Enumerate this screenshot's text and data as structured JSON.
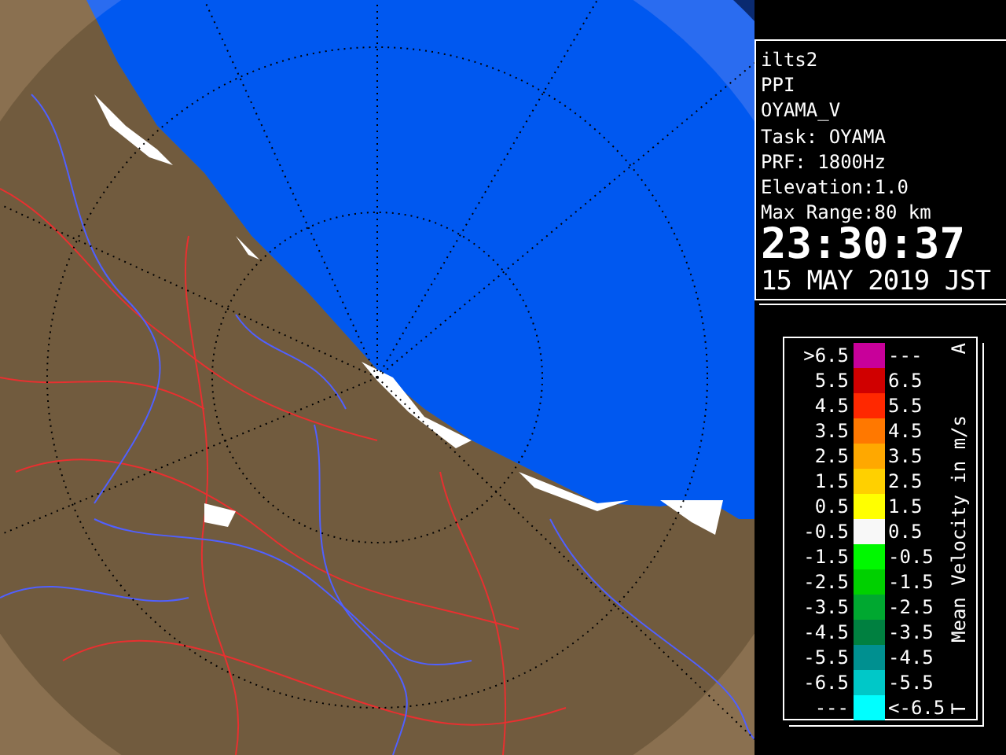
{
  "info": {
    "lines": [
      "ilts2",
      "PPI",
      "OYAMA_V",
      "Task: OYAMA",
      "PRF: 1800Hz",
      "Elevation:1.0",
      "Max Range:80 km"
    ],
    "time": "23:30:37",
    "date": "15 MAY 2019 JST"
  },
  "legend": {
    "title": "Mean Velocity in m/s",
    "top_mark": "A",
    "bottom_mark": "T",
    "rows": [
      {
        "low": ">6.5",
        "high": "---",
        "color": "#c8009a"
      },
      {
        "low": "5.5",
        "high": "6.5",
        "color": "#d00000"
      },
      {
        "low": "4.5",
        "high": "5.5",
        "color": "#ff2800"
      },
      {
        "low": "3.5",
        "high": "4.5",
        "color": "#ff7800"
      },
      {
        "low": "2.5",
        "high": "3.5",
        "color": "#ffa800"
      },
      {
        "low": "1.5",
        "high": "2.5",
        "color": "#ffd000"
      },
      {
        "low": "0.5",
        "high": "1.5",
        "color": "#ffff00"
      },
      {
        "low": "-0.5",
        "high": "0.5",
        "color": "#f8f8f8"
      },
      {
        "low": "-1.5",
        "high": "-0.5",
        "color": "#00f800"
      },
      {
        "low": "-2.5",
        "high": "-1.5",
        "color": "#00d000"
      },
      {
        "low": "-3.5",
        "high": "-2.5",
        "color": "#00a830"
      },
      {
        "low": "-4.5",
        "high": "-3.5",
        "color": "#008040"
      },
      {
        "low": "-5.5",
        "high": "-4.5",
        "color": "#009090"
      },
      {
        "low": "-6.5",
        "high": "-5.5",
        "color": "#00c8c8"
      },
      {
        "low": "---",
        "high": "<-6.5",
        "color": "#00ffff"
      }
    ]
  }
}
